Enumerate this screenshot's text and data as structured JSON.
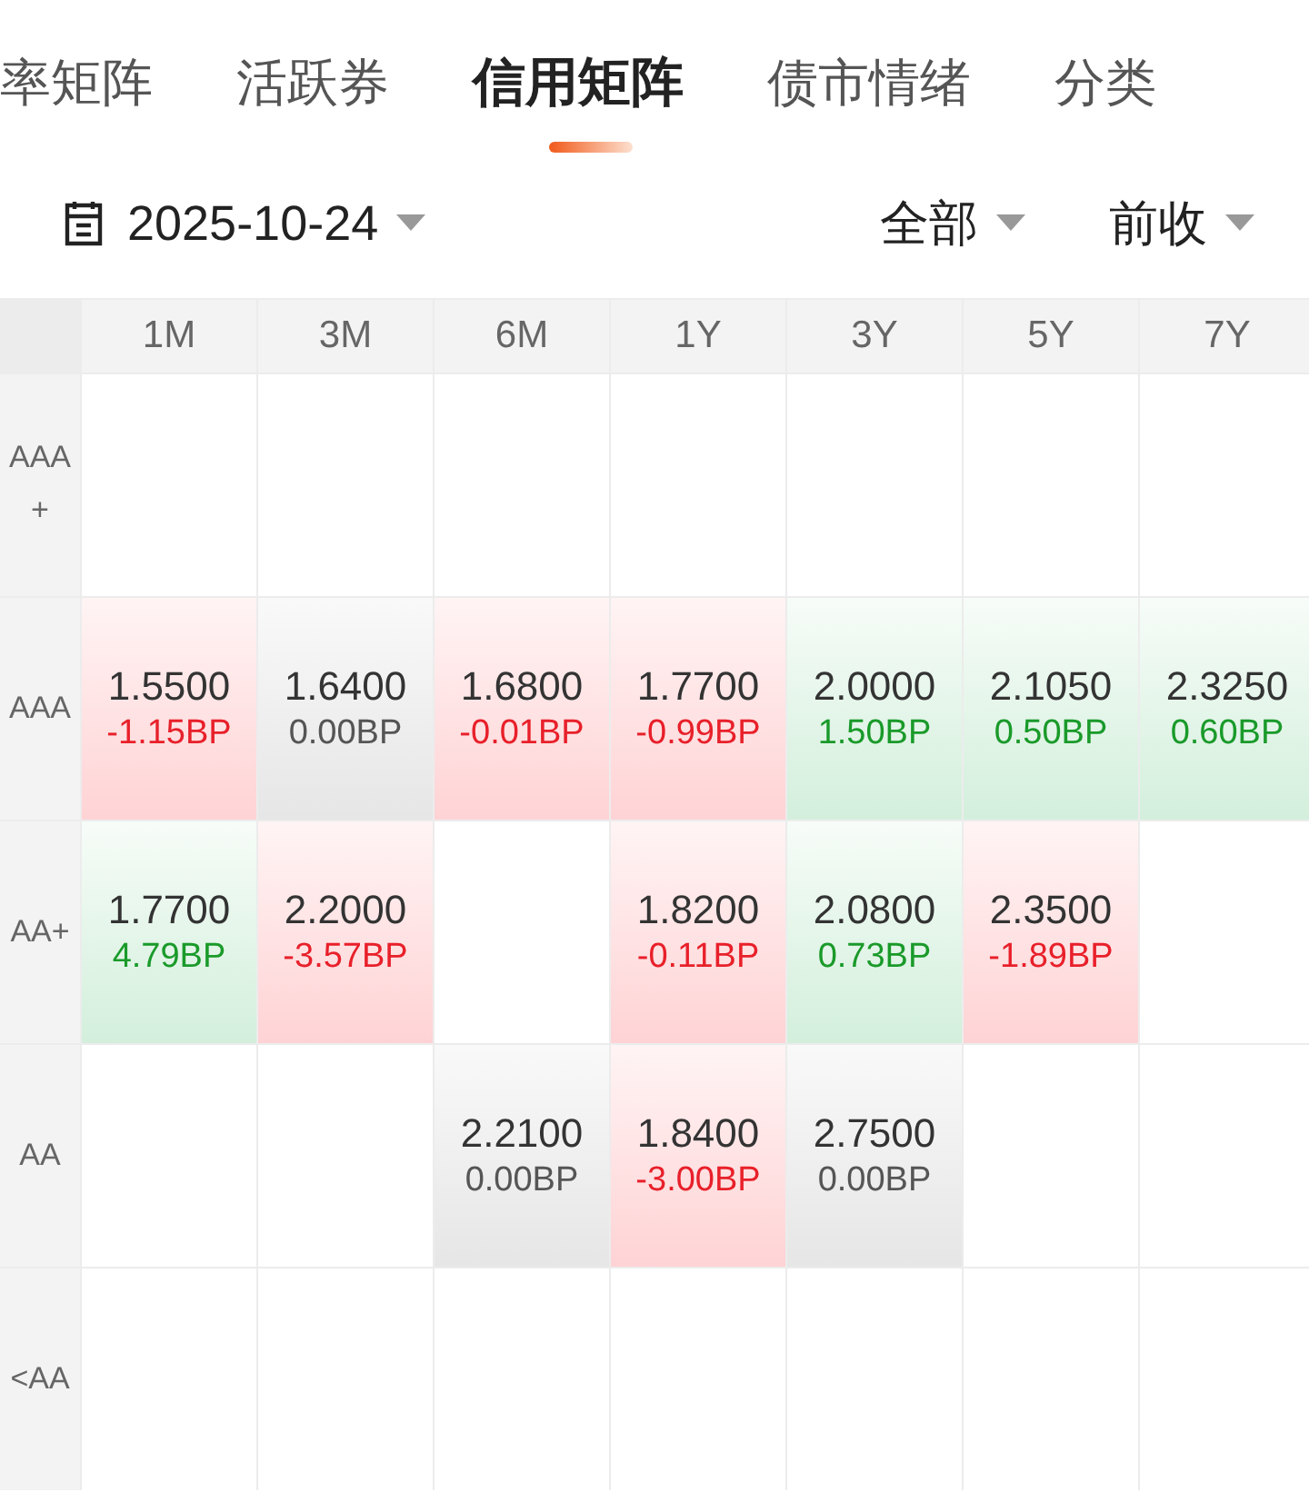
{
  "tabs": [
    {
      "label": "率矩阵",
      "selected": false
    },
    {
      "label": "活跃券",
      "selected": false
    },
    {
      "label": "信用矩阵",
      "selected": true
    },
    {
      "label": "债市情绪",
      "selected": false
    },
    {
      "label": "分类",
      "selected": false
    }
  ],
  "filters": {
    "date": "2025-10-24",
    "scope": "全部",
    "price": "前收"
  },
  "table": {
    "columns": [
      "1M",
      "3M",
      "6M",
      "1Y",
      "3Y",
      "5Y",
      "7Y"
    ],
    "rows": [
      {
        "rating": "AAA+",
        "cells": [
          null,
          null,
          null,
          null,
          null,
          null,
          null
        ]
      },
      {
        "rating": "AAA",
        "cells": [
          {
            "yield": "1.5500",
            "change": "-1.15BP",
            "kind": "down"
          },
          {
            "yield": "1.6400",
            "change": "0.00BP",
            "kind": "flat"
          },
          {
            "yield": "1.6800",
            "change": "-0.01BP",
            "kind": "down"
          },
          {
            "yield": "1.7700",
            "change": "-0.99BP",
            "kind": "down"
          },
          {
            "yield": "2.0000",
            "change": "1.50BP",
            "kind": "up"
          },
          {
            "yield": "2.1050",
            "change": "0.50BP",
            "kind": "up"
          },
          {
            "yield": "2.3250",
            "change": "0.60BP",
            "kind": "up"
          }
        ]
      },
      {
        "rating": "AA+",
        "cells": [
          {
            "yield": "1.7700",
            "change": "4.79BP",
            "kind": "up"
          },
          {
            "yield": "2.2000",
            "change": "-3.57BP",
            "kind": "down"
          },
          null,
          {
            "yield": "1.8200",
            "change": "-0.11BP",
            "kind": "down"
          },
          {
            "yield": "2.0800",
            "change": "0.73BP",
            "kind": "up"
          },
          {
            "yield": "2.3500",
            "change": "-1.89BP",
            "kind": "down"
          },
          null
        ]
      },
      {
        "rating": "AA",
        "cells": [
          null,
          null,
          {
            "yield": "2.2100",
            "change": "0.00BP",
            "kind": "flat"
          },
          {
            "yield": "1.8400",
            "change": "-3.00BP",
            "kind": "down"
          },
          {
            "yield": "2.7500",
            "change": "0.00BP",
            "kind": "flat"
          },
          null,
          null
        ]
      },
      {
        "rating": "<AA",
        "cells": [
          null,
          null,
          null,
          null,
          null,
          null,
          null
        ]
      }
    ]
  }
}
